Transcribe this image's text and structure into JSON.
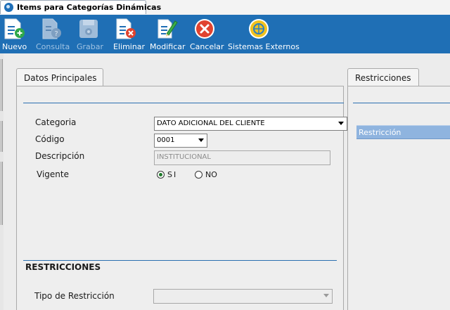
{
  "window": {
    "tab_title": "Items para Categorías Dinámicas"
  },
  "toolbar": {
    "buttons": [
      {
        "label": "Nuevo",
        "enabled": true,
        "icon": "new-document-plus-icon"
      },
      {
        "label": "Consulta",
        "enabled": false,
        "icon": "document-question-icon"
      },
      {
        "label": "Grabar",
        "enabled": false,
        "icon": "save-disk-icon"
      },
      {
        "label": "Eliminar",
        "enabled": true,
        "icon": "document-delete-icon"
      },
      {
        "label": "Modificar",
        "enabled": true,
        "icon": "edit-pencil-icon"
      },
      {
        "label": "Cancelar",
        "enabled": true,
        "icon": "cancel-x-icon"
      },
      {
        "label": "Sistemas Externos",
        "enabled": true,
        "icon": "external-systems-icon"
      }
    ],
    "color": "#1f6fb5"
  },
  "datos": {
    "tab_label": "Datos Principales",
    "categoria_label": "Categoria",
    "categoria_value": "DATO ADICIONAL DEL CLIENTE",
    "codigo_label": "Código",
    "codigo_value": "0001",
    "descripcion_label": "Descripción",
    "descripcion_value": "INSTITUCIONAL",
    "vigente_label": "Vigente",
    "vigente_si": "SI",
    "vigente_no": "NO",
    "vigente_selected": "SI"
  },
  "restricciones_section": {
    "title": "RESTRICCIONES",
    "tipo_label": "Tipo de Restricción",
    "tipo_value": ""
  },
  "restricciones_panel": {
    "tab_label": "Restricciones",
    "column_header": "Restricción",
    "header_color": "#8fb4df"
  }
}
